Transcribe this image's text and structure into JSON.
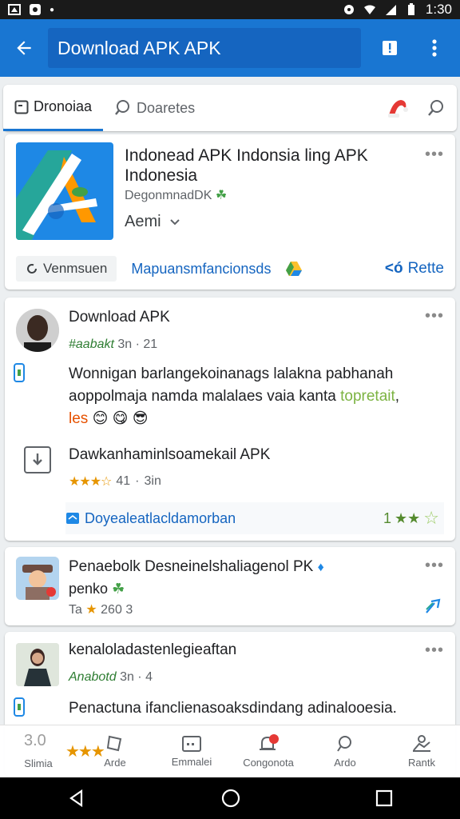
{
  "status_bar": {
    "time": "1:30"
  },
  "app_bar": {
    "search_text": "Download APK APK"
  },
  "tabs": {
    "active_label": "Dronoiaa",
    "inactive_label": "Doaretes"
  },
  "hero": {
    "title": "Indonead APK Indonsia ling APK Indonesia",
    "developer": "DegonmnadDK",
    "meta_label": "Aemi",
    "chip_label": "Venmsuen",
    "link_label": "Mapuansmfancionsds",
    "retry_label": "Rette"
  },
  "post1": {
    "name": "Download APK",
    "handle": "#aabakt",
    "time": "3n · 21",
    "text_line1": "Wonnigan barlangekoinanags lalakna pabhanah",
    "text_line2_a": "aoppolmaja namda malalaes vaia kanta ",
    "text_line2_b": "topretait",
    "text_line2_c": ",",
    "text_line3": "les",
    "sub_title": "Dawkanhaminlsoamekail APK",
    "sub_rating": "41",
    "sub_time": "3in",
    "link_text": "Doyealeatlacldamorban",
    "link_rating": "1"
  },
  "post2": {
    "name": "Penaebolk Desneinelshaliagenol PK",
    "sub": "penko",
    "meta_a": "Ta",
    "meta_b": "260",
    "meta_c": "3"
  },
  "post3": {
    "name": "kenaloladastenlegieaftan",
    "handle": "Anabotd",
    "time": "3n · 4",
    "text": "Penactuna ifanclienasoaksdindang adinalooesia."
  },
  "bottom_nav": [
    {
      "label": "Slimia",
      "icon": "star-icon"
    },
    {
      "label": "Arde",
      "icon": "tag-icon"
    },
    {
      "label": "Emmalei",
      "icon": "media-icon"
    },
    {
      "label": "Congonota",
      "icon": "bell-icon"
    },
    {
      "label": "Ardo",
      "icon": "pin-icon"
    },
    {
      "label": "Rantk",
      "icon": "person-icon"
    }
  ],
  "bottom_nav_extra": "3.0",
  "colors": {
    "primary": "#1976d2",
    "link": "#1565c0",
    "star": "#e69500",
    "accent_green": "#2e7d32"
  }
}
